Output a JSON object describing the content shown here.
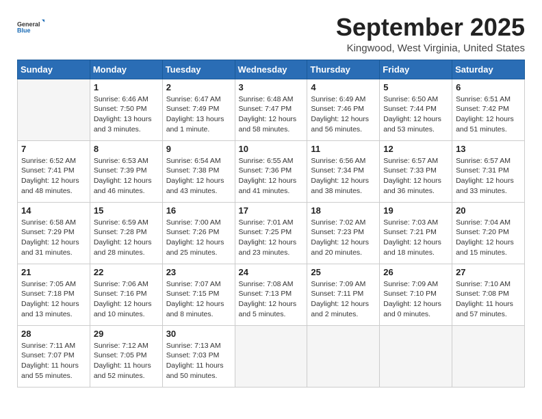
{
  "logo": {
    "text_general": "General",
    "text_blue": "Blue"
  },
  "header": {
    "month": "September 2025",
    "location": "Kingwood, West Virginia, United States"
  },
  "weekdays": [
    "Sunday",
    "Monday",
    "Tuesday",
    "Wednesday",
    "Thursday",
    "Friday",
    "Saturday"
  ],
  "weeks": [
    [
      {
        "day": "",
        "empty": true
      },
      {
        "day": "1",
        "sunrise": "Sunrise: 6:46 AM",
        "sunset": "Sunset: 7:50 PM",
        "daylight": "Daylight: 13 hours and 3 minutes."
      },
      {
        "day": "2",
        "sunrise": "Sunrise: 6:47 AM",
        "sunset": "Sunset: 7:49 PM",
        "daylight": "Daylight: 13 hours and 1 minute."
      },
      {
        "day": "3",
        "sunrise": "Sunrise: 6:48 AM",
        "sunset": "Sunset: 7:47 PM",
        "daylight": "Daylight: 12 hours and 58 minutes."
      },
      {
        "day": "4",
        "sunrise": "Sunrise: 6:49 AM",
        "sunset": "Sunset: 7:46 PM",
        "daylight": "Daylight: 12 hours and 56 minutes."
      },
      {
        "day": "5",
        "sunrise": "Sunrise: 6:50 AM",
        "sunset": "Sunset: 7:44 PM",
        "daylight": "Daylight: 12 hours and 53 minutes."
      },
      {
        "day": "6",
        "sunrise": "Sunrise: 6:51 AM",
        "sunset": "Sunset: 7:42 PM",
        "daylight": "Daylight: 12 hours and 51 minutes."
      }
    ],
    [
      {
        "day": "7",
        "sunrise": "Sunrise: 6:52 AM",
        "sunset": "Sunset: 7:41 PM",
        "daylight": "Daylight: 12 hours and 48 minutes."
      },
      {
        "day": "8",
        "sunrise": "Sunrise: 6:53 AM",
        "sunset": "Sunset: 7:39 PM",
        "daylight": "Daylight: 12 hours and 46 minutes."
      },
      {
        "day": "9",
        "sunrise": "Sunrise: 6:54 AM",
        "sunset": "Sunset: 7:38 PM",
        "daylight": "Daylight: 12 hours and 43 minutes."
      },
      {
        "day": "10",
        "sunrise": "Sunrise: 6:55 AM",
        "sunset": "Sunset: 7:36 PM",
        "daylight": "Daylight: 12 hours and 41 minutes."
      },
      {
        "day": "11",
        "sunrise": "Sunrise: 6:56 AM",
        "sunset": "Sunset: 7:34 PM",
        "daylight": "Daylight: 12 hours and 38 minutes."
      },
      {
        "day": "12",
        "sunrise": "Sunrise: 6:57 AM",
        "sunset": "Sunset: 7:33 PM",
        "daylight": "Daylight: 12 hours and 36 minutes."
      },
      {
        "day": "13",
        "sunrise": "Sunrise: 6:57 AM",
        "sunset": "Sunset: 7:31 PM",
        "daylight": "Daylight: 12 hours and 33 minutes."
      }
    ],
    [
      {
        "day": "14",
        "sunrise": "Sunrise: 6:58 AM",
        "sunset": "Sunset: 7:29 PM",
        "daylight": "Daylight: 12 hours and 31 minutes."
      },
      {
        "day": "15",
        "sunrise": "Sunrise: 6:59 AM",
        "sunset": "Sunset: 7:28 PM",
        "daylight": "Daylight: 12 hours and 28 minutes."
      },
      {
        "day": "16",
        "sunrise": "Sunrise: 7:00 AM",
        "sunset": "Sunset: 7:26 PM",
        "daylight": "Daylight: 12 hours and 25 minutes."
      },
      {
        "day": "17",
        "sunrise": "Sunrise: 7:01 AM",
        "sunset": "Sunset: 7:25 PM",
        "daylight": "Daylight: 12 hours and 23 minutes."
      },
      {
        "day": "18",
        "sunrise": "Sunrise: 7:02 AM",
        "sunset": "Sunset: 7:23 PM",
        "daylight": "Daylight: 12 hours and 20 minutes."
      },
      {
        "day": "19",
        "sunrise": "Sunrise: 7:03 AM",
        "sunset": "Sunset: 7:21 PM",
        "daylight": "Daylight: 12 hours and 18 minutes."
      },
      {
        "day": "20",
        "sunrise": "Sunrise: 7:04 AM",
        "sunset": "Sunset: 7:20 PM",
        "daylight": "Daylight: 12 hours and 15 minutes."
      }
    ],
    [
      {
        "day": "21",
        "sunrise": "Sunrise: 7:05 AM",
        "sunset": "Sunset: 7:18 PM",
        "daylight": "Daylight: 12 hours and 13 minutes."
      },
      {
        "day": "22",
        "sunrise": "Sunrise: 7:06 AM",
        "sunset": "Sunset: 7:16 PM",
        "daylight": "Daylight: 12 hours and 10 minutes."
      },
      {
        "day": "23",
        "sunrise": "Sunrise: 7:07 AM",
        "sunset": "Sunset: 7:15 PM",
        "daylight": "Daylight: 12 hours and 8 minutes."
      },
      {
        "day": "24",
        "sunrise": "Sunrise: 7:08 AM",
        "sunset": "Sunset: 7:13 PM",
        "daylight": "Daylight: 12 hours and 5 minutes."
      },
      {
        "day": "25",
        "sunrise": "Sunrise: 7:09 AM",
        "sunset": "Sunset: 7:11 PM",
        "daylight": "Daylight: 12 hours and 2 minutes."
      },
      {
        "day": "26",
        "sunrise": "Sunrise: 7:09 AM",
        "sunset": "Sunset: 7:10 PM",
        "daylight": "Daylight: 12 hours and 0 minutes."
      },
      {
        "day": "27",
        "sunrise": "Sunrise: 7:10 AM",
        "sunset": "Sunset: 7:08 PM",
        "daylight": "Daylight: 11 hours and 57 minutes."
      }
    ],
    [
      {
        "day": "28",
        "sunrise": "Sunrise: 7:11 AM",
        "sunset": "Sunset: 7:07 PM",
        "daylight": "Daylight: 11 hours and 55 minutes."
      },
      {
        "day": "29",
        "sunrise": "Sunrise: 7:12 AM",
        "sunset": "Sunset: 7:05 PM",
        "daylight": "Daylight: 11 hours and 52 minutes."
      },
      {
        "day": "30",
        "sunrise": "Sunrise: 7:13 AM",
        "sunset": "Sunset: 7:03 PM",
        "daylight": "Daylight: 11 hours and 50 minutes."
      },
      {
        "day": "",
        "empty": true
      },
      {
        "day": "",
        "empty": true
      },
      {
        "day": "",
        "empty": true
      },
      {
        "day": "",
        "empty": true
      }
    ]
  ]
}
